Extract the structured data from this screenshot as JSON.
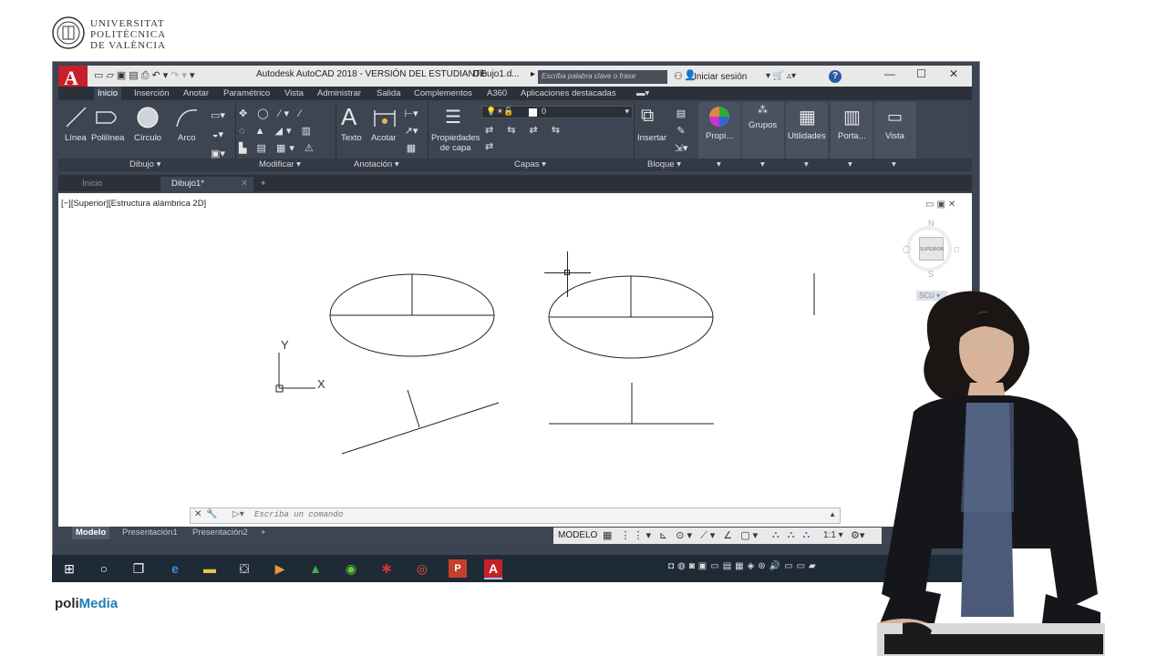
{
  "header": {
    "university_lines": [
      "UNIVERSITAT",
      "POLITÈCNICA",
      "DE VALÈNCIA"
    ],
    "footer_brand_a": "poli",
    "footer_brand_b": "Media"
  },
  "acad": {
    "app_letter": "A",
    "window_title": "Autodesk AutoCAD 2018 - VERSIÓN DEL ESTUDIANTE",
    "doc_title": "Dibujo1.d...",
    "search_placeholder": "Escriba palabra clave o frase",
    "signin": "Iniciar sesión",
    "ribbon_tabs": [
      "Inicio",
      "Inserción",
      "Anotar",
      "Paramétrico",
      "Vista",
      "Administrar",
      "Salida",
      "Complementos",
      "A360",
      "Aplicaciones destacadas"
    ],
    "draw_tools": [
      "Línea",
      "Polilínea",
      "Círculo",
      "Arco"
    ],
    "annotate_tools": [
      "Texto",
      "Acotar"
    ],
    "layer_props_line1": "Propiedades",
    "layer_props_line2": "de capa",
    "layer_value": "0",
    "block_tool": "Insertar",
    "right_buttons": [
      "Propi...",
      "Grupos",
      "Utilidades",
      "Porta...",
      "Vista"
    ],
    "panel_labels": [
      "Dibujo",
      "Modificar",
      "Anotación",
      "Capas",
      "Bloque"
    ],
    "doc_tabs": [
      "Inicio",
      "Dibujo1*"
    ],
    "viewport_label": "[−][Superior][Estructura alámbrica 2D]",
    "viewcube": {
      "north": "N",
      "south": "S",
      "face": "SUPERIOR",
      "ucs": "SCU"
    },
    "ucs_x": "X",
    "ucs_y": "Y",
    "cmd_placeholder": "Escriba un comando",
    "layout_tabs": [
      "Modelo",
      "Presentación1",
      "Presentación2"
    ],
    "status_mode": "MODELO",
    "scale": "1:1"
  },
  "colors": {
    "acad_red": "#c6202a",
    "ribbon_dark": "#3d4452",
    "taskbar": "#1f2a37",
    "polimedia_blue": "#1c7db2"
  }
}
